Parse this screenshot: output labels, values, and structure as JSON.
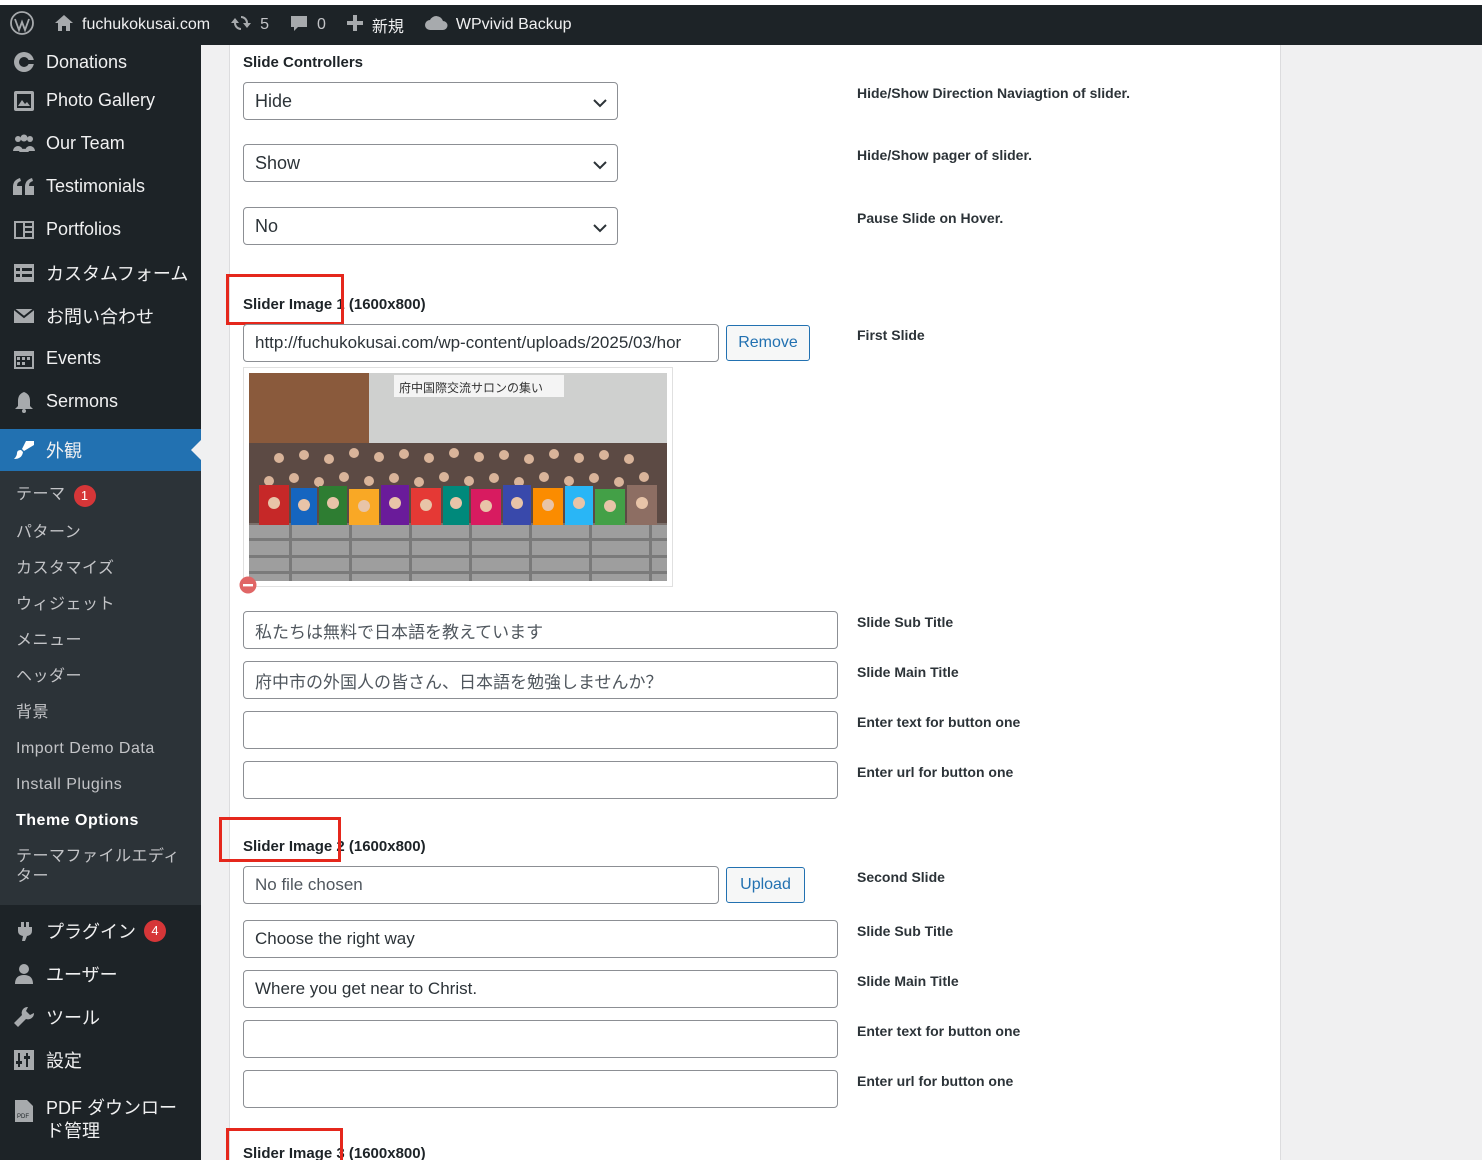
{
  "adminbar": {
    "site_name": "fuchukokusai.com",
    "updates_count": "5",
    "comments_count": "0",
    "new_label": "新規",
    "backup_label": "WPvivid Backup"
  },
  "sidebar": {
    "items": [
      {
        "label": "Donations"
      },
      {
        "label": "Photo Gallery"
      },
      {
        "label": "Our Team"
      },
      {
        "label": "Testimonials"
      },
      {
        "label": "Portfolios"
      },
      {
        "label": "カスタムフォーム"
      },
      {
        "label": "お問い合わせ"
      },
      {
        "label": "Events"
      },
      {
        "label": "Sermons"
      }
    ],
    "current": {
      "label": "外観"
    },
    "submenu": [
      {
        "label": "テーマ",
        "badge": "1"
      },
      {
        "label": "パターン"
      },
      {
        "label": "カスタマイズ"
      },
      {
        "label": "ウィジェット"
      },
      {
        "label": "メニュー"
      },
      {
        "label": "ヘッダー"
      },
      {
        "label": "背景"
      },
      {
        "label": "Import Demo Data"
      },
      {
        "label": "Install Plugins"
      },
      {
        "label": "Theme Options"
      },
      {
        "label": "テーマファイルエディター"
      }
    ],
    "lower_items": [
      {
        "label": "プラグイン",
        "badge": "4"
      },
      {
        "label": "ユーザー"
      },
      {
        "label": "ツール"
      },
      {
        "label": "設定"
      },
      {
        "label": "PDF ダウンロード管理"
      }
    ]
  },
  "main": {
    "slide_controllers": {
      "heading": "Slide Controllers",
      "direction_value": "Hide",
      "direction_desc": "Hide/Show Direction Naviagtion of slider.",
      "pager_value": "Show",
      "pager_desc": "Hide/Show pager of slider.",
      "pause_value": "No",
      "pause_desc": "Pause Slide on Hover."
    },
    "slide1": {
      "heading": "Slider Image 1 (1600x800)",
      "url_value": "http://fuchukokusai.com/wp-content/uploads/2025/03/hor",
      "remove_label": "Remove",
      "desc": "First Slide",
      "photo_banner": "府中国際交流サロンの集い",
      "sub_title": "私たちは無料で日本語を教えています",
      "sub_title_desc": "Slide Sub Title",
      "main_title": "府中市の外国人の皆さん、日本語を勉強しませんか？",
      "main_title_desc": "Slide Main Title",
      "button_text": "",
      "button_text_desc": "Enter text for button one",
      "button_url": "",
      "button_url_desc": "Enter url for button one"
    },
    "slide2": {
      "heading": "Slider Image 2 (1600x800)",
      "file_value": "No file chosen",
      "upload_label": "Upload",
      "desc": "Second Slide",
      "sub_title": "Choose the right way",
      "sub_title_desc": "Slide Sub Title",
      "main_title": "Where you get near to Christ.",
      "main_title_desc": "Slide Main Title",
      "button_text": "",
      "button_text_desc": "Enter text for button one",
      "button_url": "",
      "button_url_desc": "Enter url for button one"
    },
    "slide3": {
      "heading": "Slider Image 3 (1600x800)"
    }
  },
  "colors": {
    "adminbar_bg": "#1d2327",
    "sidebar_bg": "#1d2327",
    "current_menu_bg": "#2271b1",
    "highlight_red": "#e5271c",
    "badge_red": "#d63638"
  },
  "icons": {
    "adminbar": [
      "wordpress-logo-icon",
      "home-icon",
      "updates-icon",
      "comment-icon",
      "plus-icon",
      "cloud-icon"
    ],
    "sidebar": [
      "donations-icon",
      "gallery-icon",
      "team-icon",
      "quote-icon",
      "portfolio-icon",
      "form-icon",
      "mail-icon",
      "calendar-icon",
      "bell-icon",
      "brush-icon",
      "plugin-icon",
      "user-icon",
      "wrench-icon",
      "settings-icon",
      "pdf-icon"
    ]
  }
}
